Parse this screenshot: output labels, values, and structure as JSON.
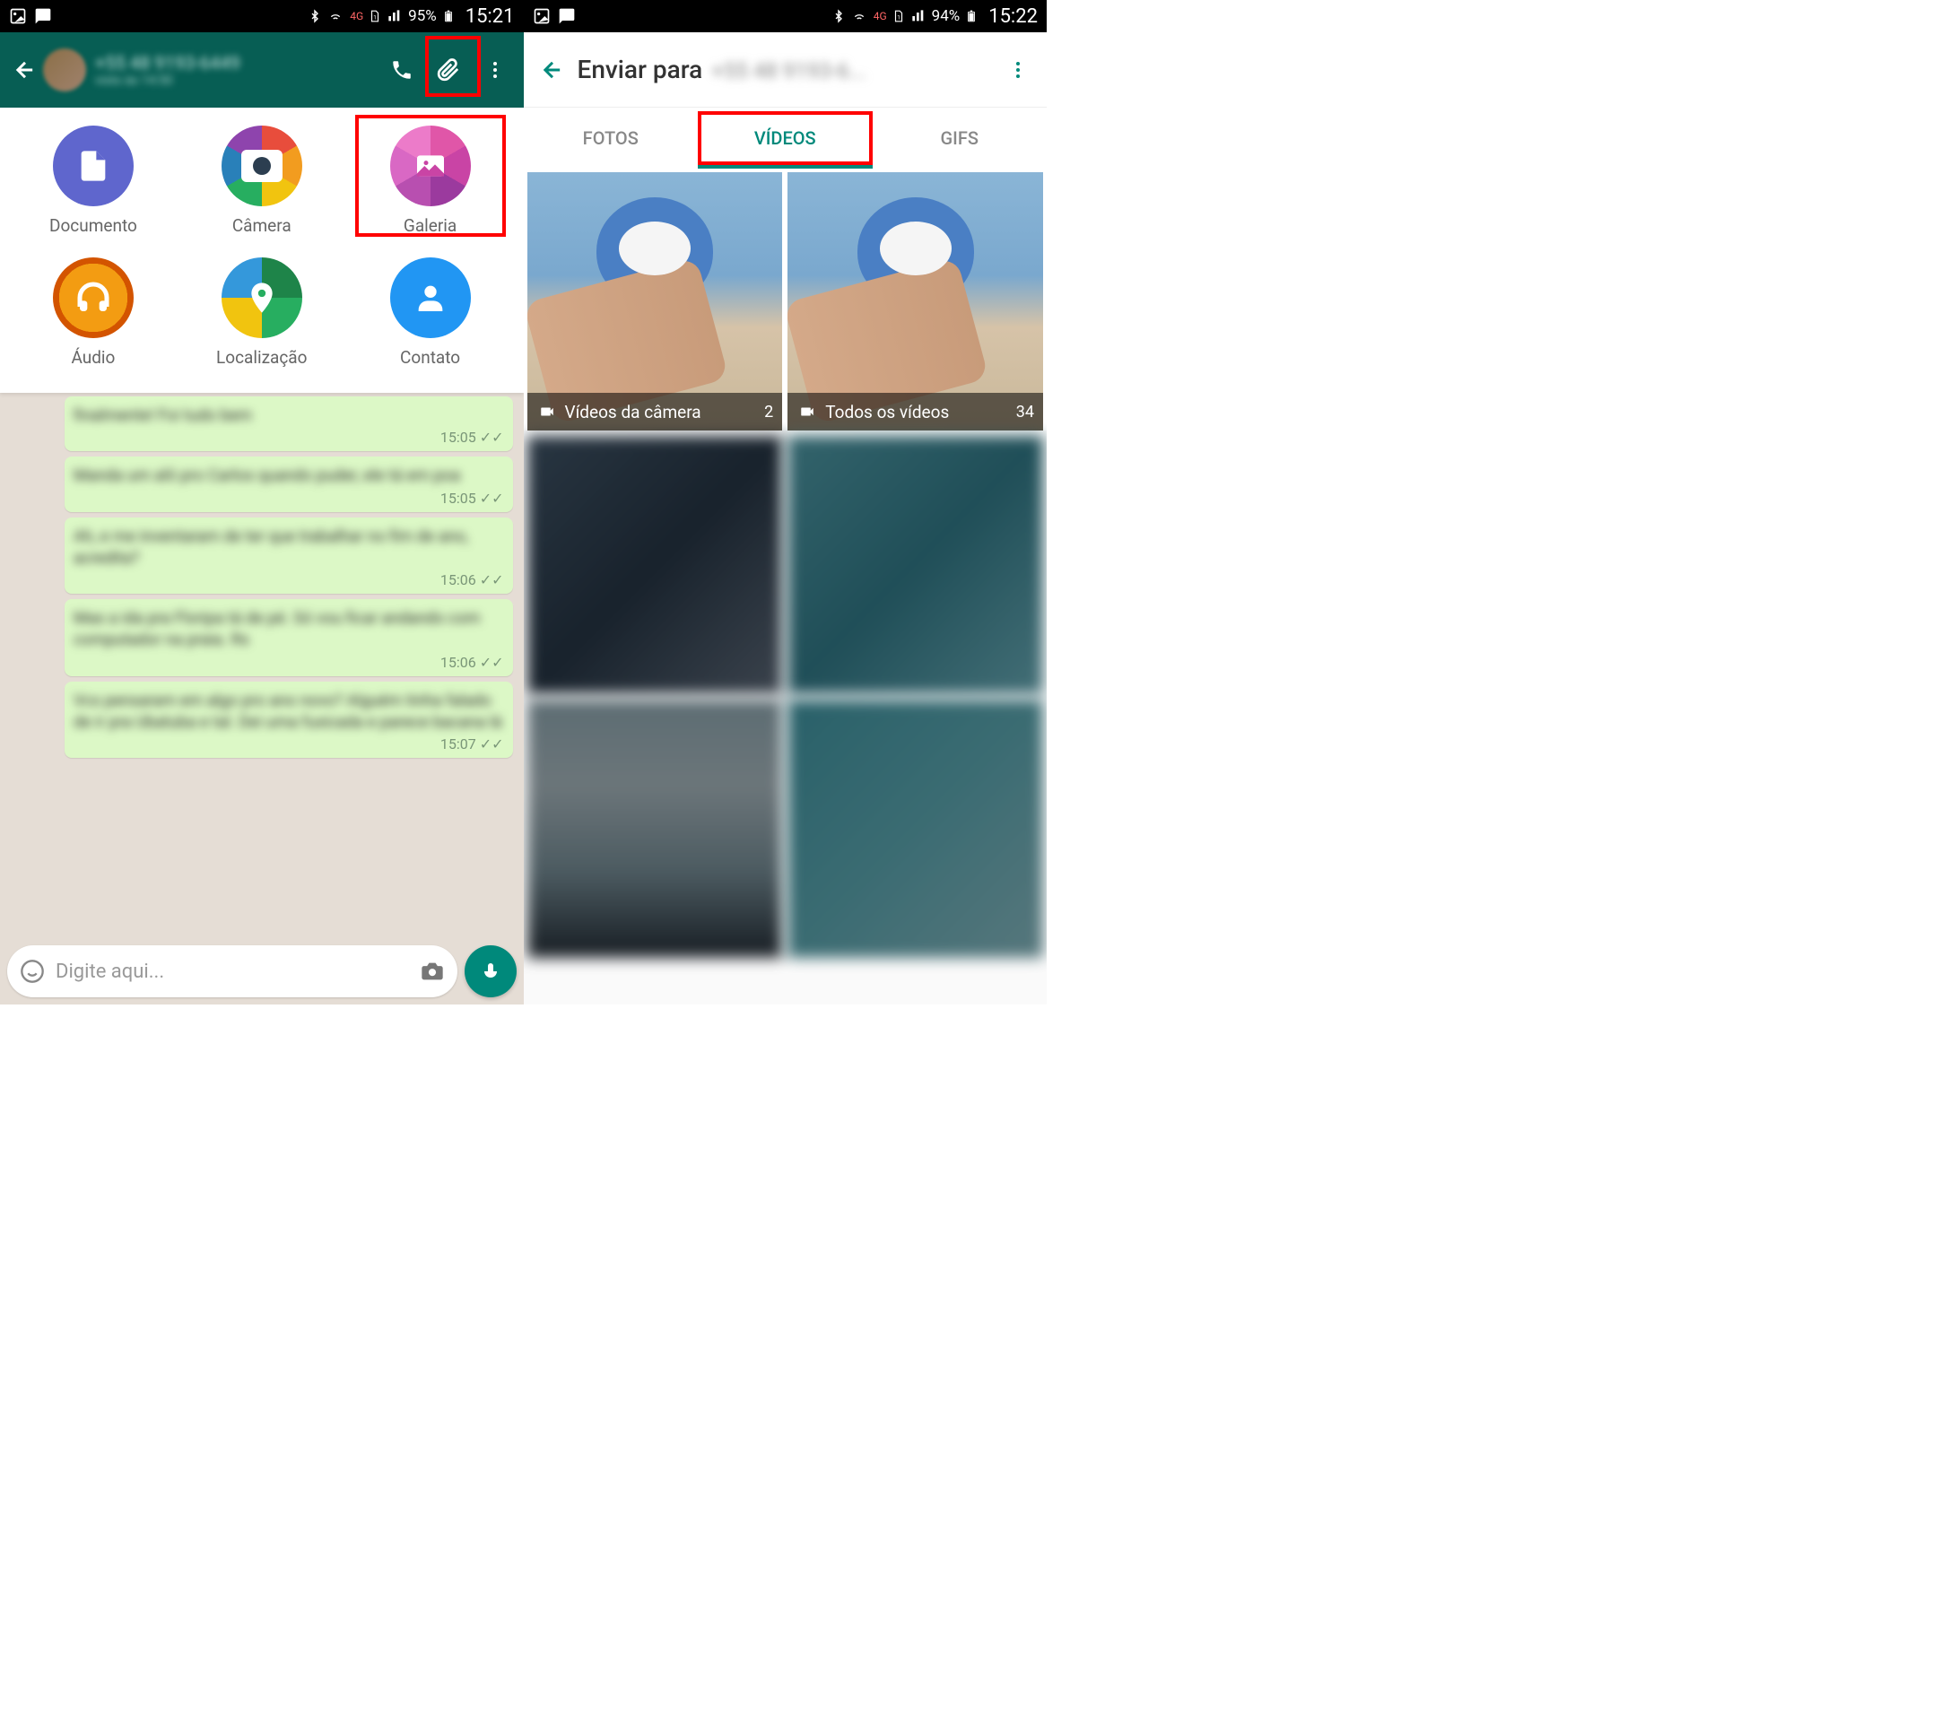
{
  "left": {
    "status": {
      "battery": "95%",
      "time": "15:21",
      "network_label": "4G"
    },
    "header": {
      "contact_name_blurred": "+55 48 9193-6449",
      "contact_status_blurred": "visto às 14:50"
    },
    "attachments": {
      "document": "Documento",
      "camera": "Câmera",
      "gallery": "Galeria",
      "audio": "Áudio",
      "location": "Localização",
      "contact": "Contato"
    },
    "messages": [
      {
        "time": "15:05"
      },
      {
        "time": "15:05"
      },
      {
        "time": "15:06"
      },
      {
        "time": "15:06"
      },
      {
        "time": "15:07"
      }
    ],
    "input": {
      "placeholder": "Digite aqui..."
    }
  },
  "right": {
    "status": {
      "battery": "94%",
      "time": "15:22",
      "network_label": "4G"
    },
    "header": {
      "title": "Enviar para",
      "number_blurred": "+55 48 9193-6..."
    },
    "tabs": {
      "fotos": "FOTOS",
      "videos": "VÍDEOS",
      "gifs": "GIFS",
      "active": "VÍDEOS"
    },
    "folders": [
      {
        "name": "Vídeos da câmera",
        "count": "2"
      },
      {
        "name": "Todos os vídeos",
        "count": "34"
      }
    ]
  }
}
